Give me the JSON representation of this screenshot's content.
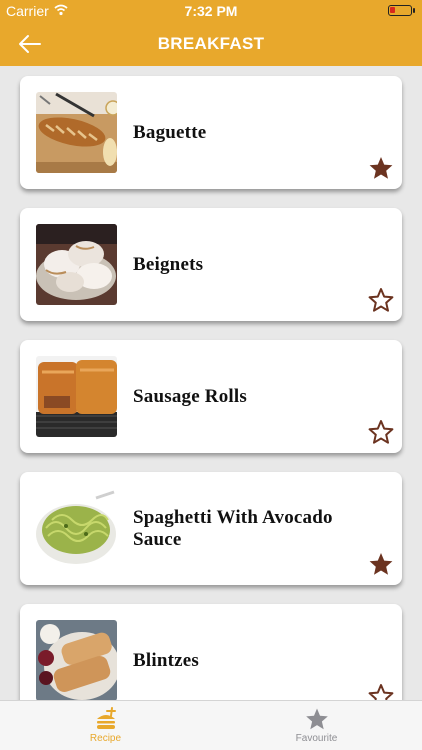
{
  "status_bar": {
    "carrier": "Carrier",
    "time": "7:32 PM",
    "battery_level": 0.2
  },
  "header": {
    "title": "BREAKFAST",
    "back_icon": "arrow-left-icon"
  },
  "recipes": [
    {
      "title": "Baguette",
      "favourite": true
    },
    {
      "title": "Beignets",
      "favourite": false
    },
    {
      "title": "Sausage Rolls",
      "favourite": false
    },
    {
      "title": "Spaghetti With Avocado Sauce",
      "favourite": true
    },
    {
      "title": "Blintzes",
      "favourite": false
    }
  ],
  "tabs": [
    {
      "label": "Recipe",
      "icon": "burger-icon",
      "active": true
    },
    {
      "label": "Favourite",
      "icon": "star-icon",
      "active": false
    }
  ],
  "colors": {
    "accent": "#e8a82c",
    "star": "#6b3320",
    "tab_inactive": "#8e8e93"
  }
}
